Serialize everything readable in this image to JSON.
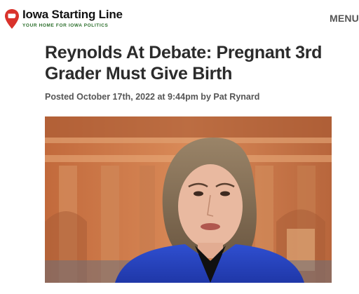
{
  "header": {
    "site_name": "Iowa Starting Line",
    "tagline": "YOUR HOME FOR IOWA POLITICS",
    "menu_label": "MENU",
    "brand_color": "#d9322b",
    "tagline_color": "#2a6e2a",
    "logo_icon": "iowa-pin-icon"
  },
  "article": {
    "title": "Reynolds At Debate: Pregnant 3rd Grader Must Give Birth",
    "byline": "Posted October 17th, 2022 at 9:44pm by Pat Rynard",
    "hero_image": "woman-blue-jacket-debate-photo"
  }
}
